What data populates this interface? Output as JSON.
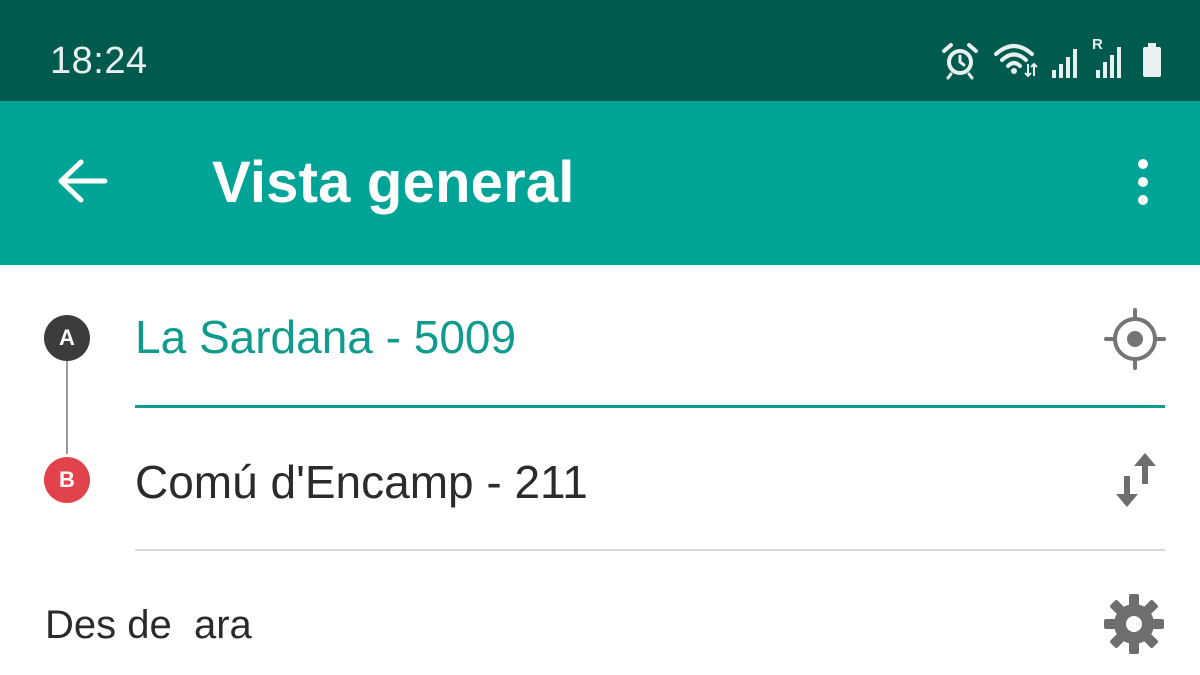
{
  "status_bar": {
    "time": "18:24",
    "icons": [
      "alarm-icon",
      "wifi-icon",
      "signal-icon",
      "roaming-signal-icon",
      "battery-icon"
    ],
    "roaming_letter": "R"
  },
  "app_bar": {
    "title": "Vista general",
    "back_icon": "arrow-left-icon",
    "menu_icon": "more-vert-icon"
  },
  "route": {
    "origin": {
      "marker": "A",
      "value": "La Sardana - 5009",
      "action_icon": "my-location-icon"
    },
    "destination": {
      "marker": "B",
      "value": "Comú d'Encamp - 211",
      "action_icon": "swap-vert-icon"
    }
  },
  "time_option": {
    "label": "Des de  ara",
    "action_icon": "settings-gear-icon"
  },
  "colors": {
    "status_bar": "#005a4e",
    "app_bar": "#00a496",
    "accent": "#0f9b8e",
    "marker_a": "#3c3c3c",
    "marker_b": "#e2434a"
  }
}
